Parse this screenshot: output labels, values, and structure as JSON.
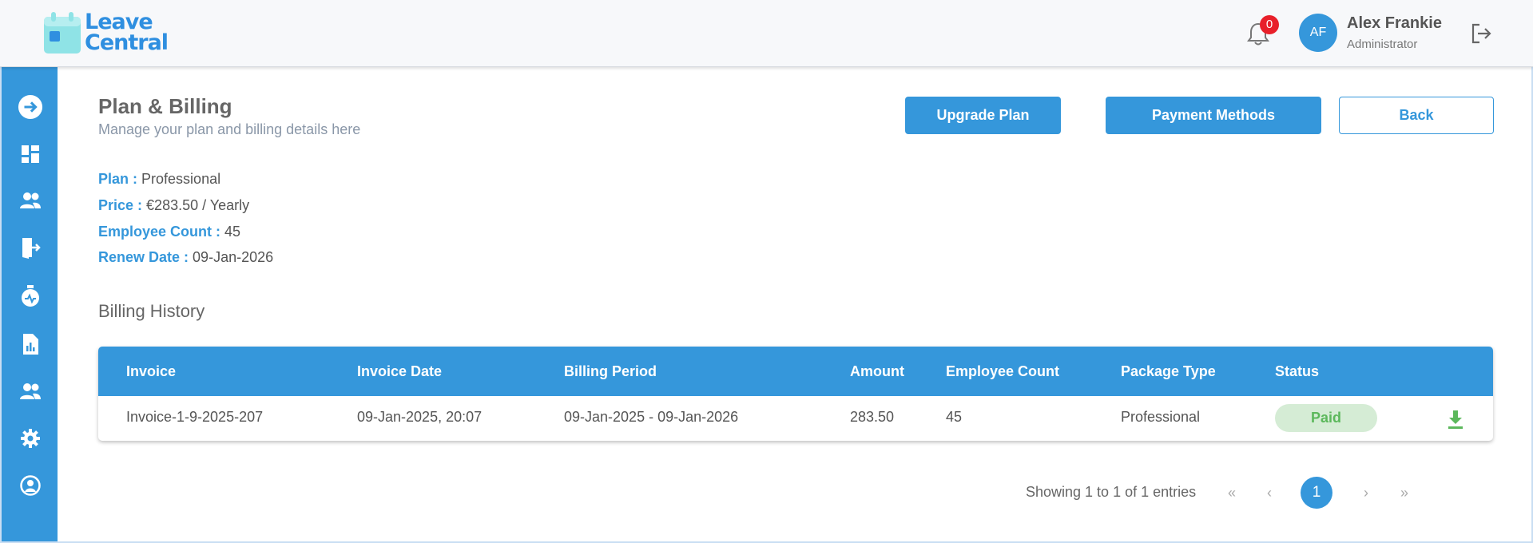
{
  "app": {
    "logo_line1": "Leave",
    "logo_line2": "Central",
    "brand_color": "#3597db"
  },
  "header": {
    "notification_count": "0",
    "avatar_initials": "AF",
    "user_name": "Alex Frankie",
    "user_role": "Administrator"
  },
  "sidebar": {
    "items": [
      {
        "icon": "arrow-right-circle-icon"
      },
      {
        "icon": "dashboard-icon"
      },
      {
        "icon": "users-icon"
      },
      {
        "icon": "leave-door-icon"
      },
      {
        "icon": "stopwatch-icon"
      },
      {
        "icon": "report-icon"
      },
      {
        "icon": "team-icon"
      },
      {
        "icon": "gear-icon"
      },
      {
        "icon": "profile-icon"
      }
    ]
  },
  "page": {
    "title": "Plan & Billing",
    "subtitle": "Manage your plan and billing details here",
    "buttons": {
      "upgrade": "Upgrade Plan",
      "payment_methods": "Payment Methods",
      "back": "Back"
    }
  },
  "plan": {
    "plan_label": "Plan :",
    "plan_value": "Professional",
    "price_label": "Price :",
    "price_value": "€283.50 / Yearly",
    "employee_label": "Employee Count :",
    "employee_value": "45",
    "renew_label": "Renew Date :",
    "renew_value": "09-Jan-2026"
  },
  "billing": {
    "section_title": "Billing History",
    "columns": [
      "Invoice",
      "Invoice Date",
      "Billing Period",
      "Amount",
      "Employee Count",
      "Package Type",
      "Status"
    ],
    "rows": [
      {
        "invoice": "Invoice-1-9-2025-207",
        "invoice_date": "09-Jan-2025, 20:07",
        "billing_period": "09-Jan-2025 - 09-Jan-2026",
        "amount": "283.50",
        "employee_count": "45",
        "package_type": "Professional",
        "status": "Paid"
      }
    ]
  },
  "pagination": {
    "summary": "Showing 1 to 1 of 1 entries",
    "first": "«",
    "prev": "‹",
    "current": "1",
    "next": "›",
    "last": "»"
  }
}
